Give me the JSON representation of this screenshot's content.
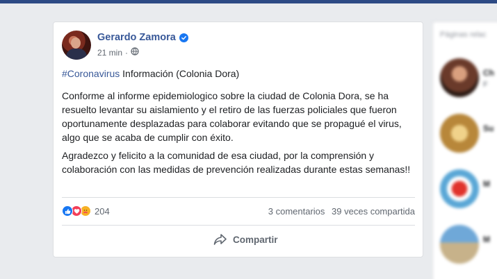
{
  "post": {
    "author": "Gerardo Zamora",
    "time": "21 min",
    "separator": "·",
    "hashtag": "#Coronavirus",
    "headline_rest": " Información (Colonia Dora)",
    "paragraph_1": "Conforme al informe epidemiologico sobre la ciudad de Colonia Dora, se ha resuelto levantar su aislamiento y el retiro de las fuerzas policiales que fueron oportunamente desplazadas para colaborar evitando que se propagué el virus, algo que se acaba de cumplir con éxito.",
    "paragraph_2": "Agradezco y felicito a la comunidad de esa ciudad, por la comprensión y colaboración con las medidas de prevención realizadas durante estas semanas!!",
    "reaction_count": "204",
    "comments": "3 comentarios",
    "shares": "39 veces compartida",
    "share_label": "Compartir",
    "reaction_icons": [
      "like-icon",
      "love-icon",
      "care-icon"
    ]
  },
  "sidebar": {
    "title": "Páginas relac",
    "items": [
      {
        "name": "Ch",
        "sub": "F"
      },
      {
        "name": "Su",
        "sub": ""
      },
      {
        "name": "M",
        "sub": ""
      },
      {
        "name": "M",
        "sub": ""
      }
    ]
  },
  "colors": {
    "topbar": "#2d4a84",
    "link": "#385898",
    "background": "#e9ebee",
    "like": "#1877f2",
    "love": "#f33e58",
    "care": "#f7b125"
  }
}
